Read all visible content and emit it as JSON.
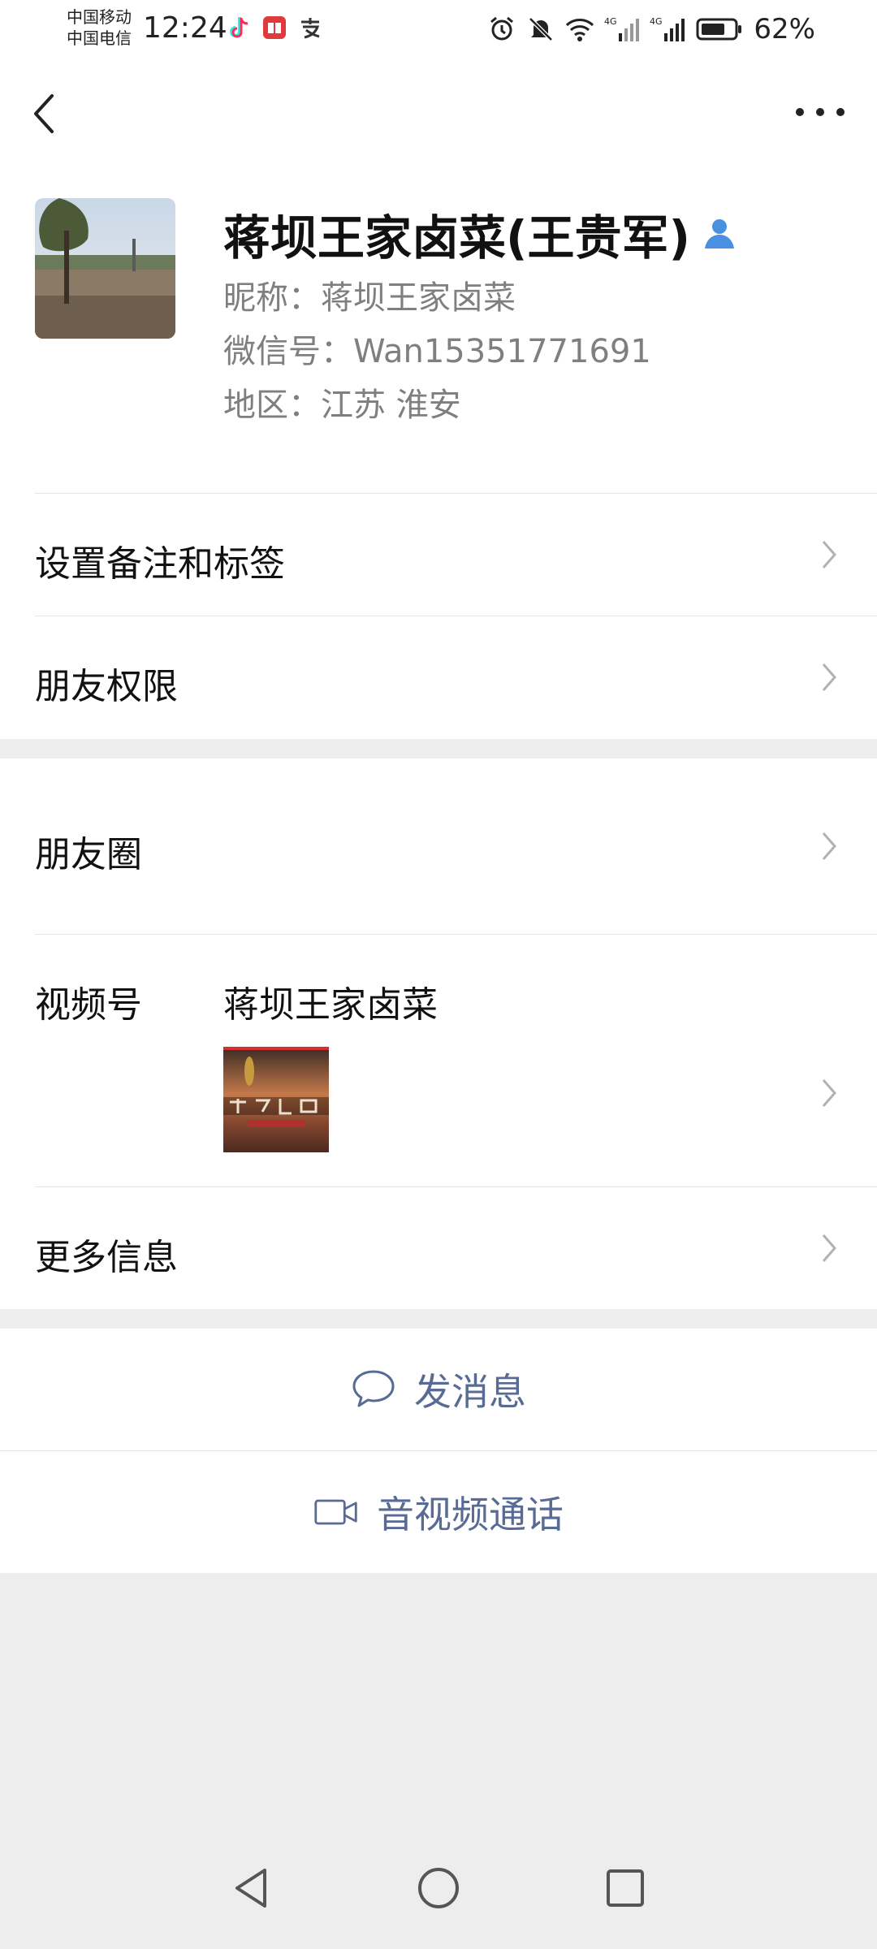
{
  "status_bar": {
    "carrier_1": "中国移动",
    "carrier_2": "中国电信",
    "time": "12:24",
    "app_icons": [
      "tiktok-icon",
      "reader-icon",
      "alipay-icon"
    ],
    "battery": "62%",
    "signal_label_1": "4G",
    "signal_label_2": "4G"
  },
  "profile": {
    "name": "蒋坝王家卤菜(王贵军)",
    "nickname": "昵称：蒋坝王家卤菜",
    "wechat_id": "微信号：Wan15351771691",
    "region": "地区：江苏  淮安"
  },
  "menu": {
    "remark_tags": "设置备注和标签",
    "friend_permissions": "朋友权限",
    "moments": "朋友圈",
    "channels": "视频号",
    "channels_name": "蒋坝王家卤菜",
    "more_info": "更多信息"
  },
  "actions": {
    "send_message": "发消息",
    "video_call": "音视频通话"
  },
  "colors": {
    "link_blue": "#576b95",
    "background": "#ededed",
    "verified_icon": "#4a90e2"
  }
}
